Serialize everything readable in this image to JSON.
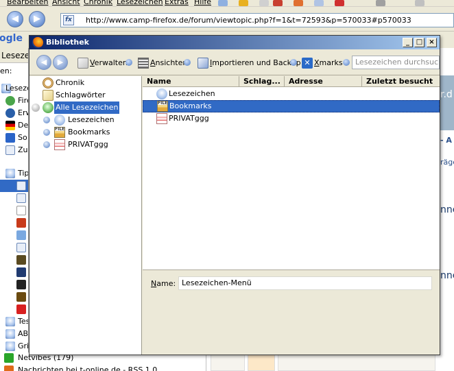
{
  "browser": {
    "menu": [
      "Bearbeiten",
      "Ansicht",
      "Chronik",
      "Lesezeichen",
      "Extras",
      "Hilfe"
    ],
    "url": "http://www.camp-firefox.de/forum/viewtopic.php?f=1&t=72593&p=570033#p570033",
    "search_engine_label": "ogle",
    "sidebar": {
      "title": "Lesezeichen",
      "search_label": "en:",
      "items": [
        "Lesezeichen-Sy",
        "Fire",
        "Erw",
        "De",
        "So",
        "Zur",
        "Tip",
        "Tes",
        "AB",
        "Gri"
      ]
    },
    "bottom_items": [
      "Netvibes (179)",
      "Nachrichten bei t-online.de - RSS 1.0"
    ],
    "page_fragments": [
      "r.d",
      "- A",
      "räge",
      "nne",
      "nne"
    ]
  },
  "dialog": {
    "title": "Bibliothek",
    "window_buttons": [
      "_",
      "□",
      "×"
    ],
    "toolbar": {
      "back": "◀",
      "forward": "▶",
      "verwalten": "Verwalten",
      "ansichten": "Ansichten",
      "import": "Importieren und Backup",
      "xmarks": "Xmarks",
      "search_placeholder": "Lesezeichen durchsuchen"
    },
    "left_tree": [
      {
        "label": "Chronik",
        "icon": "history-clock-icon"
      },
      {
        "label": "Schlagwörter",
        "icon": "tag-icon"
      },
      {
        "label": "Alle Lesezeichen",
        "icon": "all-bookmarks-icon",
        "selected": true
      },
      {
        "label": "Lesezeichen",
        "icon": "bookmark-folder-icon"
      },
      {
        "label": "Bookmarks",
        "icon": "file-folder-icon"
      },
      {
        "label": "PRIVATggg",
        "icon": "private-folder-icon"
      }
    ],
    "columns": [
      "Name",
      "Schlag...",
      "Adresse",
      "Zuletzt besucht"
    ],
    "rows": [
      {
        "label": "Lesezeichen",
        "icon": "bookmark-folder-icon"
      },
      {
        "label": "Bookmarks",
        "icon": "file-folder-icon",
        "selected": true
      },
      {
        "label": "PRIVATggg",
        "icon": "private-folder-icon"
      }
    ],
    "detail": {
      "name_label": "Name:",
      "name_value": "Lesezeichen-Menü"
    }
  }
}
